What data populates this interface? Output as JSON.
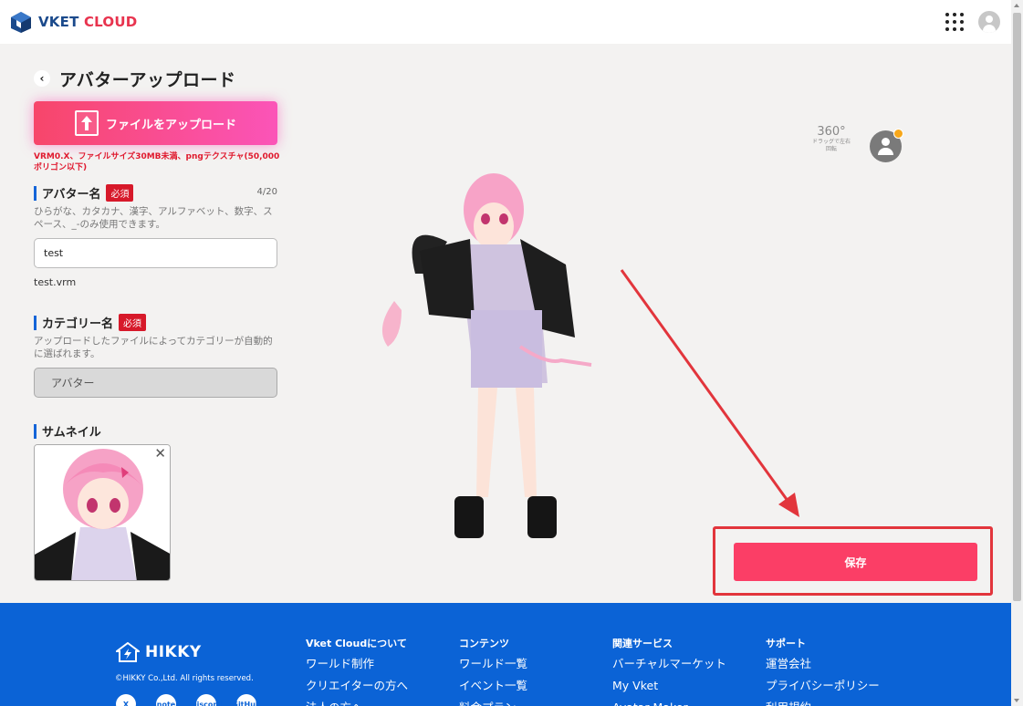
{
  "header": {
    "logo_vket": "VKET",
    "logo_cloud": "CLOUD"
  },
  "page": {
    "title": "アバターアップロード",
    "back_icon": "chevron-left-icon"
  },
  "upload": {
    "label": "ファイルをアップロード",
    "note": "VRM0.X、ファイルサイズ30MB未満、pngテクスチャ(50,000ポリゴン以下)"
  },
  "avatar_name": {
    "label": "アバター名",
    "required": "必須",
    "counter": "4/20",
    "help": "ひらがな、カタカナ、漢字、アルファベット、数字、スペース、_-のみ使用できます。",
    "value": "test",
    "filename": "test.vrm"
  },
  "category": {
    "label": "カテゴリー名",
    "required": "必須",
    "help": "アップロードしたファイルによってカテゴリーが自動的に選ばれます。",
    "value": "アバター"
  },
  "thumbnail": {
    "label": "サムネイル",
    "close": "✕"
  },
  "viewer": {
    "rotate_number": "360°",
    "rotate_hint": "ドラッグで左右回転"
  },
  "save": {
    "label": "保存"
  },
  "annotation_color": "#e2353c",
  "footer": {
    "brand": "HIKKY",
    "copyright": "©HIKKY Co.,Ltd. All rights reserved.",
    "social": [
      "X",
      "note",
      "Discord",
      "GitHub"
    ],
    "columns": [
      {
        "heading": "Vket Cloudについて",
        "links": [
          "ワールド制作",
          "クリエイターの方へ",
          "法人の方へ"
        ]
      },
      {
        "heading": "コンテンツ",
        "links": [
          "ワールド一覧",
          "イベント一覧",
          "料金プラン"
        ]
      },
      {
        "heading": "関連サービス",
        "links": [
          "バーチャルマーケット",
          "My Vket",
          "Avatar Maker"
        ]
      },
      {
        "heading": "サポート",
        "links": [
          "運営会社",
          "プライバシーポリシー",
          "利用規約"
        ]
      }
    ]
  }
}
